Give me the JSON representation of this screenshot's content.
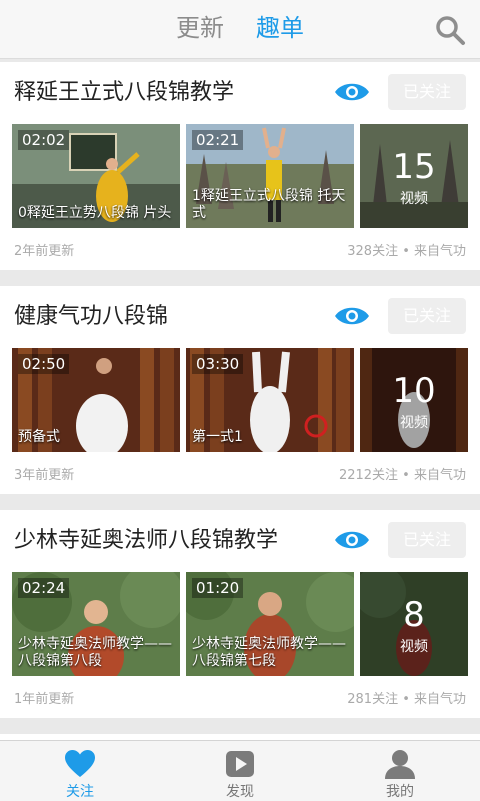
{
  "header": {
    "tabs": [
      {
        "label": "更新",
        "active": false
      },
      {
        "label": "趣单",
        "active": true
      }
    ],
    "search_icon": "search-icon"
  },
  "colors": {
    "accent": "#1e9be8",
    "follow_button_bg": "#eeeeee",
    "meta_text": "#aaaaaa"
  },
  "cards": [
    {
      "title": "释延王立式八段锦教学",
      "follow_label": "已关注",
      "videos": [
        {
          "duration": "02:02",
          "caption": "0释延王立势八段锦 片头"
        },
        {
          "duration": "02:21",
          "caption": "1释延王立式八段锦 托天式"
        }
      ],
      "video_count": "15",
      "video_count_label": "视频",
      "updated": "2年前更新",
      "stats": "328关注 • 来自气功"
    },
    {
      "title": "健康气功八段锦",
      "follow_label": "已关注",
      "videos": [
        {
          "duration": "02:50",
          "caption": "预备式"
        },
        {
          "duration": "03:30",
          "caption": "第一式1"
        }
      ],
      "video_count": "10",
      "video_count_label": "视频",
      "updated": "3年前更新",
      "stats": "2212关注 • 来自气功"
    },
    {
      "title": "少林寺延奥法师八段锦教学",
      "follow_label": "已关注",
      "videos": [
        {
          "duration": "02:24",
          "caption": "少林寺延奥法师教学——八段锦第八段"
        },
        {
          "duration": "01:20",
          "caption": "少林寺延奥法师教学——八段锦第七段"
        }
      ],
      "video_count": "8",
      "video_count_label": "视频",
      "updated": "1年前更新",
      "stats": "281关注 • 来自气功"
    }
  ],
  "bottom_nav": [
    {
      "label": "关注",
      "icon": "heart-icon",
      "active": true
    },
    {
      "label": "发现",
      "icon": "play-icon",
      "active": false
    },
    {
      "label": "我的",
      "icon": "user-icon",
      "active": false
    }
  ]
}
